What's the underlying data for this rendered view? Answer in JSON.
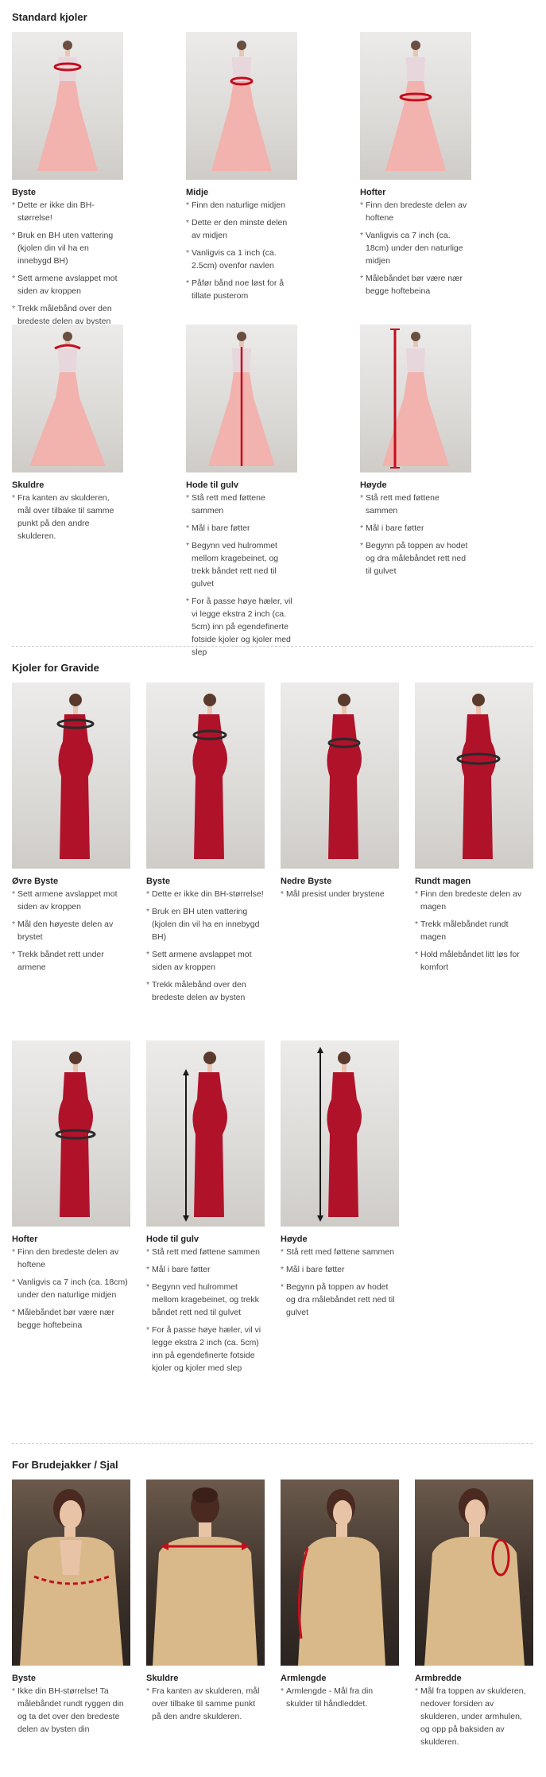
{
  "sections": {
    "standard": {
      "title": "Standard kjoler",
      "items": [
        {
          "title": "Byste",
          "tips": [
            "Dette er ikke din BH-størrelse!",
            "Bruk en BH uten vattering (kjolen din vil ha en innebygd BH)",
            "Sett armene avslappet mot siden av kroppen",
            "Trekk målebånd over den bredeste delen av bysten"
          ]
        },
        {
          "title": "Midje",
          "tips": [
            "Finn den naturlige midjen",
            "Dette er den minste delen av midjen",
            "Vanligvis ca 1 inch (ca. 2.5cm) ovenfor navlen",
            "Påfør bånd noe løst for å tillate pusterom"
          ]
        },
        {
          "title": "Hofter",
          "tips": [
            "Finn den bredeste delen av hoftene",
            "Vanligvis ca 7 inch (ca. 18cm) under den naturlige midjen",
            "Målebåndet bør være nær begge hoftebeina"
          ]
        },
        {
          "title": "Skuldre",
          "tips": [
            "Fra kanten av skulderen, mål over tilbake til samme punkt på den andre skulderen."
          ]
        },
        {
          "title": "Hode til gulv",
          "tips": [
            "Stå rett med føttene sammen",
            "Mål i bare føtter",
            "Begynn ved hulrommet mellom kragebeinet, og trekk båndet rett ned til gulvet",
            "For å passe høye hæler, vil vi legge ekstra 2 inch (ca. 5cm) inn på egendefinerte fotside kjoler og kjoler med slep"
          ]
        },
        {
          "title": "Høyde",
          "tips": [
            "Stå rett med føttene sammen",
            "Mål i bare føtter",
            "Begynn på toppen av hodet og dra målebåndet rett ned til gulvet"
          ]
        }
      ]
    },
    "pregnant": {
      "title": "Kjoler for Gravide",
      "items": [
        {
          "title": "Øvre Byste",
          "tips": [
            "Sett armene avslappet mot siden av kroppen",
            "Mål den høyeste delen av brystet",
            "Trekk båndet rett under armene"
          ]
        },
        {
          "title": "Byste",
          "tips": [
            "Dette er ikke din BH-størrelse!",
            "Bruk en BH uten vattering (kjolen din vil ha en innebygd BH)",
            "Sett armene avslappet mot siden av kroppen",
            "Trekk målebånd over den bredeste delen av bysten"
          ]
        },
        {
          "title": "Nedre Byste",
          "tips": [
            "Mål presist under brystene"
          ]
        },
        {
          "title": "Rundt magen",
          "tips": [
            "Finn den bredeste delen av magen",
            "Trekk målebåndet rundt magen",
            "Hold målebåndet litt løs for komfort"
          ]
        },
        {
          "title": "Hofter",
          "tips": [
            "Finn den bredeste delen av hoftene",
            "Vanligvis ca 7 inch (ca. 18cm) under den naturlige midjen",
            "Målebåndet bør være nær begge hoftebeina"
          ]
        },
        {
          "title": "Hode til gulv",
          "tips": [
            "Stå rett med føttene sammen",
            "Mål i bare føtter",
            "Begynn ved hulrommet mellom kragebeinet, og trekk båndet rett ned til gulvet",
            "For å passe høye hæler, vil vi legge ekstra 2 inch (ca. 5cm) inn på egendefinerte fotside kjoler og kjoler med slep"
          ]
        },
        {
          "title": "Høyde",
          "tips": [
            "Stå rett med føttene sammen",
            "Mål i bare føtter",
            "Begynn på toppen av hodet og dra målebåndet rett ned til gulvet"
          ]
        }
      ]
    },
    "jackets": {
      "title": "For Brudejakker / Sjal",
      "items": [
        {
          "title": "Byste",
          "tips": [
            "Ikke din BH-størrelse! Ta målebåndet rundt ryggen din og ta det over den bredeste delen av bysten din"
          ]
        },
        {
          "title": "Skuldre",
          "tips": [
            "Fra kanten av skulderen, mål over tilbake til samme punkt på den andre skulderen."
          ]
        },
        {
          "title": "Armlengde",
          "tips": [
            "Armlengde - Mål fra din skulder til håndleddet."
          ]
        },
        {
          "title": "Armbredde",
          "tips": [
            "Mål fra toppen av skulderen, nedover forsiden av skulderen, under armhulen, og opp på baksiden av skulderen."
          ]
        }
      ]
    }
  },
  "colors": {
    "pink_gown": "#f2b2ae",
    "red_gown": "#b0122a",
    "gold_jacket": "#d9b98a",
    "tape": "#c40e1c"
  },
  "icons": {
    "standard": [
      "bust-measure-icon",
      "waist-measure-icon",
      "hips-measure-icon",
      "shoulders-measure-icon",
      "hollow-to-floor-icon",
      "height-icon"
    ],
    "pregnant": [
      "upper-bust-icon",
      "bust-measure-icon",
      "under-bust-icon",
      "belly-icon",
      "hips-measure-icon",
      "hollow-to-floor-icon",
      "height-icon"
    ],
    "jackets": [
      "bust-measure-icon",
      "shoulders-measure-icon",
      "arm-length-icon",
      "arm-width-icon"
    ]
  }
}
